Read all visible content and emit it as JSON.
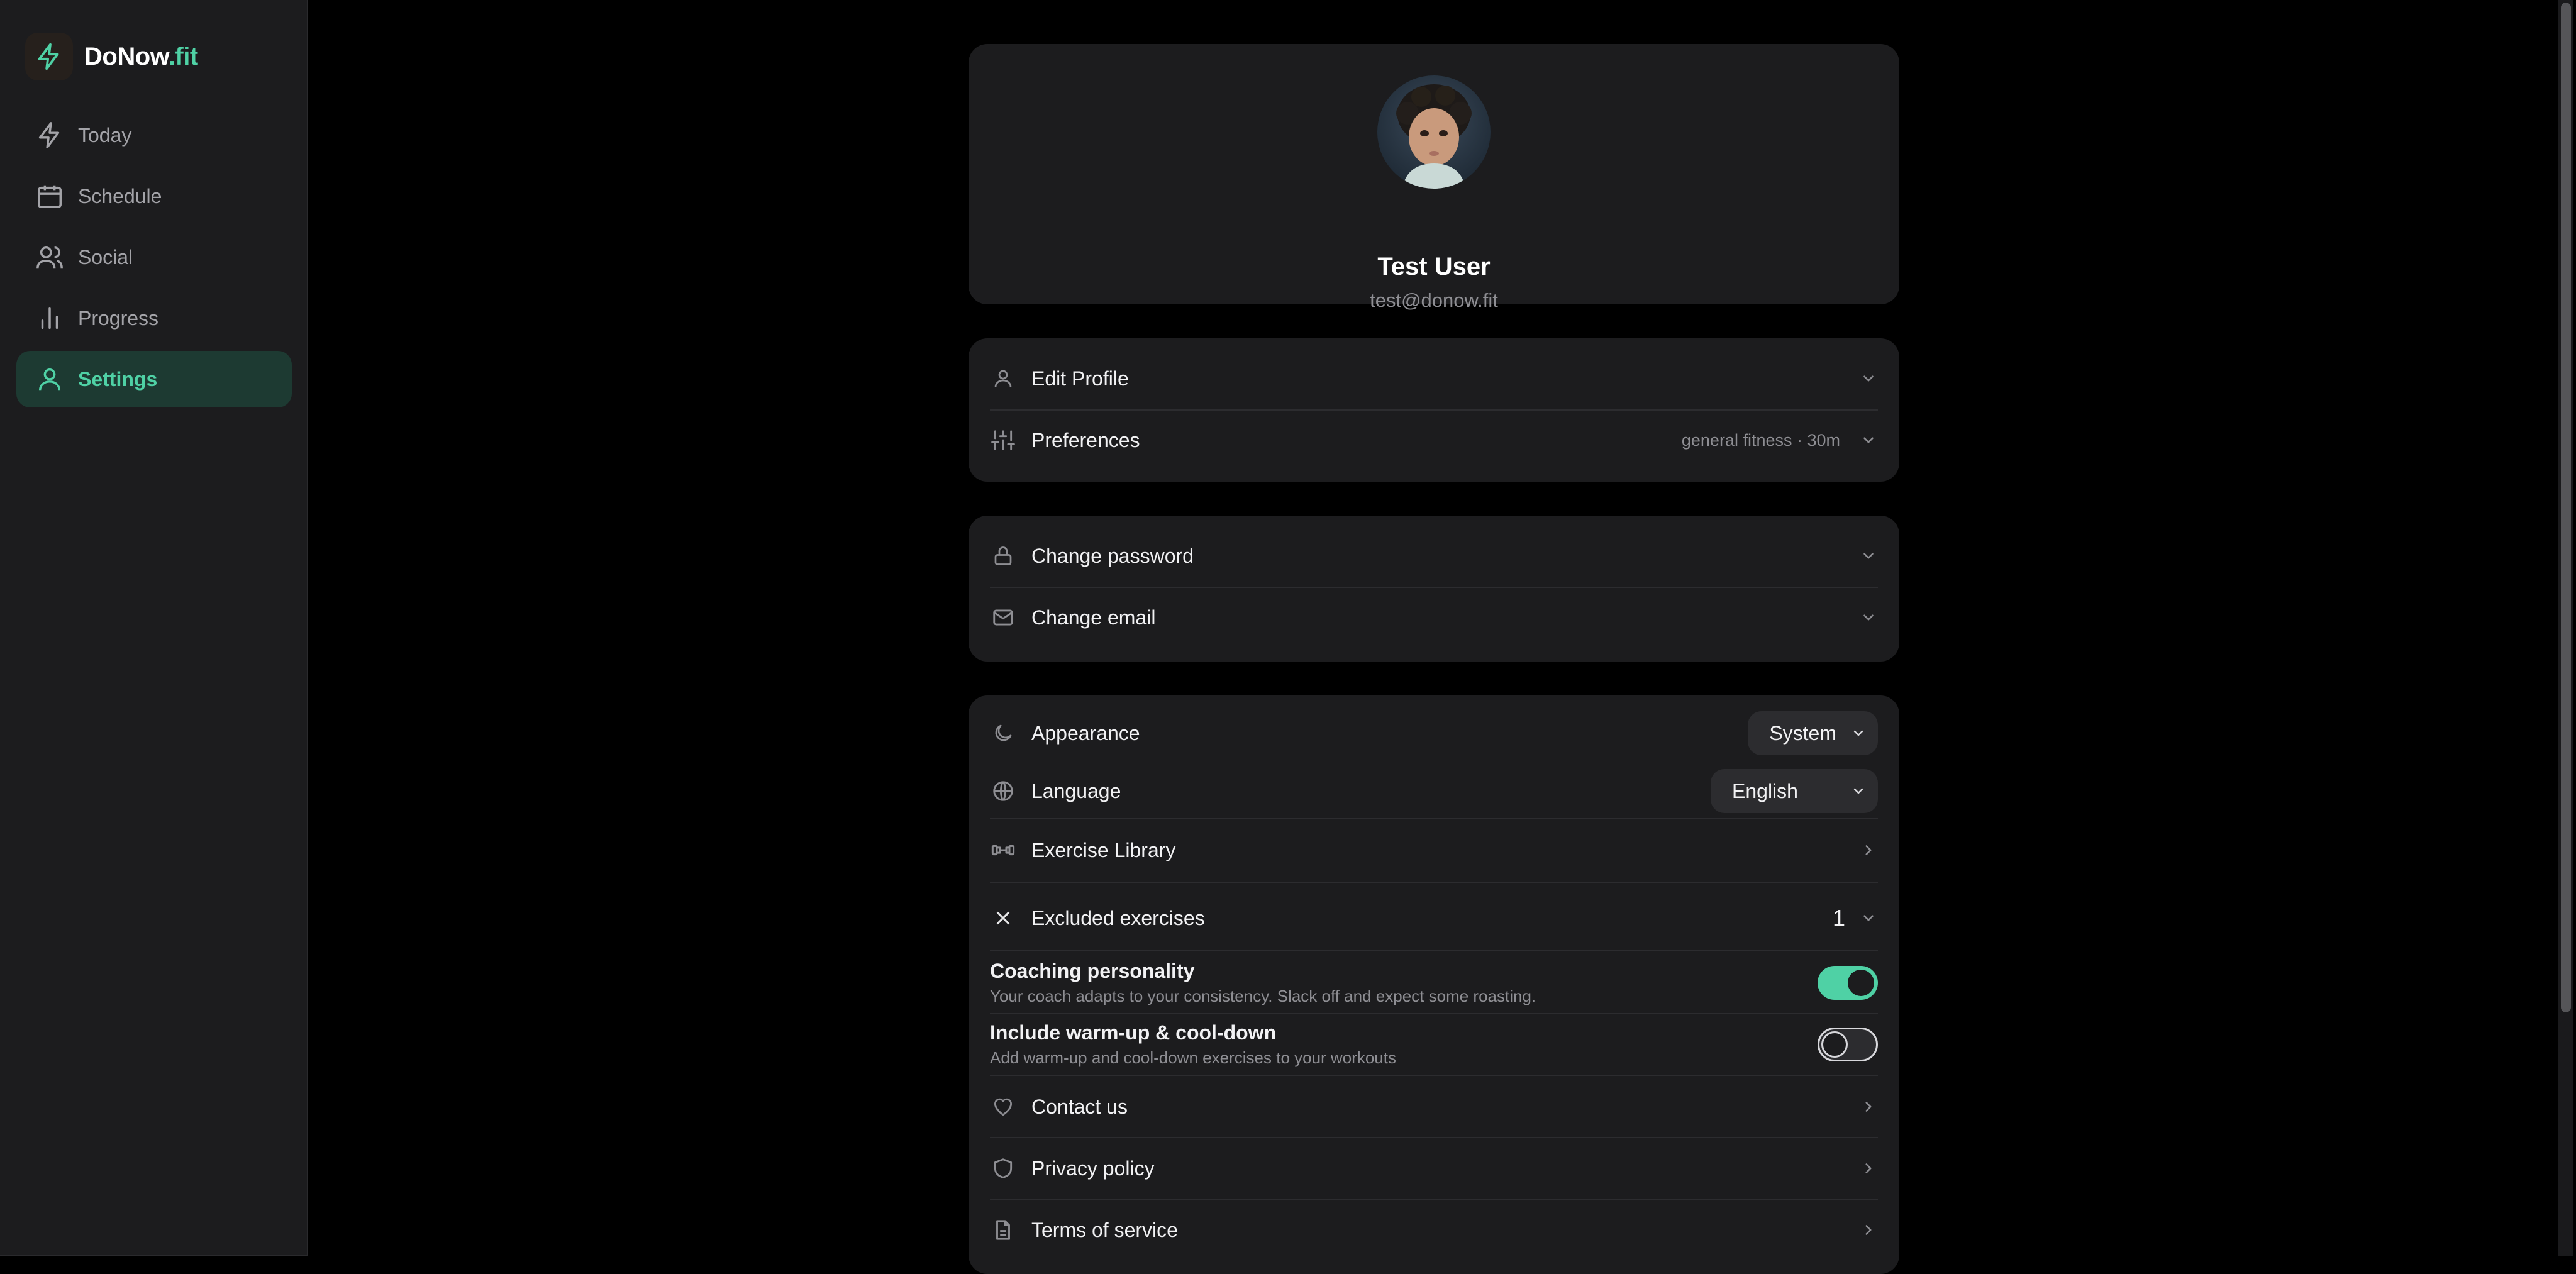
{
  "brand": {
    "name_main": "DoNow",
    "name_accent": ".fit"
  },
  "nav": {
    "items": [
      {
        "label": "Today",
        "icon": "bolt-icon",
        "active": false
      },
      {
        "label": "Schedule",
        "icon": "calendar-icon",
        "active": false
      },
      {
        "label": "Social",
        "icon": "users-icon",
        "active": false
      },
      {
        "label": "Progress",
        "icon": "bar-chart-icon",
        "active": false
      },
      {
        "label": "Settings",
        "icon": "user-icon",
        "active": true
      }
    ]
  },
  "profile": {
    "name": "Test User",
    "email": "test@donow.fit"
  },
  "account": {
    "edit_profile": "Edit Profile",
    "preferences": "Preferences",
    "preferences_meta": "general fitness · 30m"
  },
  "security": {
    "change_password": "Change password",
    "change_email": "Change email"
  },
  "settings": {
    "appearance": {
      "label": "Appearance",
      "value": "System"
    },
    "language": {
      "label": "Language",
      "value": "English"
    },
    "exercise_library": "Exercise Library",
    "excluded": {
      "label": "Excluded exercises",
      "count": "1"
    },
    "coaching": {
      "title": "Coaching personality",
      "desc": "Your coach adapts to your consistency. Slack off and expect some roasting.",
      "enabled": true
    },
    "warmup": {
      "title": "Include warm-up & cool-down",
      "desc": "Add warm-up and cool-down exercises to your workouts",
      "enabled": false
    },
    "contact": "Contact us",
    "privacy": "Privacy policy",
    "terms": "Terms of service"
  },
  "colors": {
    "accent": "#4fd1a5",
    "card": "#1c1c1e",
    "background": "#000000"
  }
}
